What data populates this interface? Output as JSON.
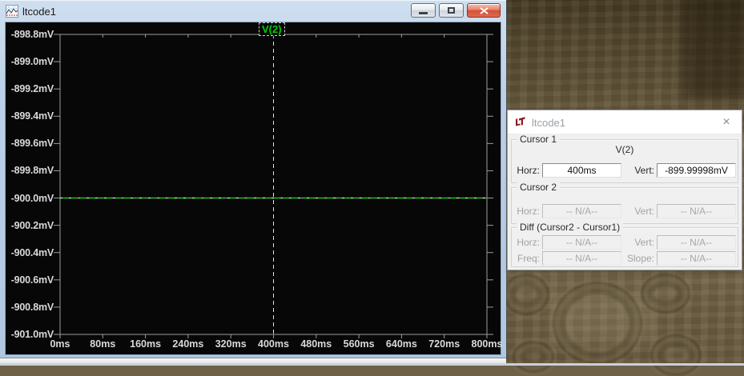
{
  "plot_window": {
    "title": "ltcode1",
    "trace_label": "V(2)",
    "trace_color": "#00d000"
  },
  "cursor_window": {
    "title": "ltcode1",
    "close_glyph": "×",
    "cursor1": {
      "legend": "Cursor 1",
      "trace": "V(2)",
      "horz_label": "Horz:",
      "horz_value": "400ms",
      "vert_label": "Vert:",
      "vert_value": "-899.99998mV"
    },
    "cursor2": {
      "legend": "Cursor 2",
      "horz_label": "Horz:",
      "horz_value": "-- N/A--",
      "vert_label": "Vert:",
      "vert_value": "-- N/A--"
    },
    "diff": {
      "legend": "Diff (Cursor2 - Cursor1)",
      "horz_label": "Horz:",
      "horz_value": "-- N/A--",
      "vert_label": "Vert:",
      "vert_value": "-- N/A--",
      "freq_label": "Freq:",
      "freq_value": "-- N/A--",
      "slope_label": "Slope:",
      "slope_value": "-- N/A--"
    }
  },
  "chart_data": {
    "type": "line",
    "title": "",
    "legend_entries": [
      "V(2)"
    ],
    "legend_position": "top-center",
    "x_ticks": [
      "0ms",
      "80ms",
      "160ms",
      "240ms",
      "320ms",
      "400ms",
      "480ms",
      "560ms",
      "640ms",
      "720ms",
      "800ms"
    ],
    "y_ticks": [
      "-898.8mV",
      "-899.0mV",
      "-899.2mV",
      "-899.4mV",
      "-899.6mV",
      "-899.8mV",
      "-900.0mV",
      "-900.2mV",
      "-900.4mV",
      "-900.6mV",
      "-900.8mV",
      "-901.0mV"
    ],
    "xlim_ms": [
      0,
      800
    ],
    "ylim_mV": [
      -901.0,
      -898.8
    ],
    "grid": false,
    "background": "#070707",
    "series": [
      {
        "name": "V(2)",
        "color": "#00d000",
        "x_ms": [
          0,
          800
        ],
        "y_mV": [
          -900.0,
          -900.0
        ]
      }
    ],
    "cursor1": {
      "horz": "400ms",
      "vert": "-899.99998mV",
      "horz_ms": 400,
      "vert_mV": -899.99998
    }
  }
}
